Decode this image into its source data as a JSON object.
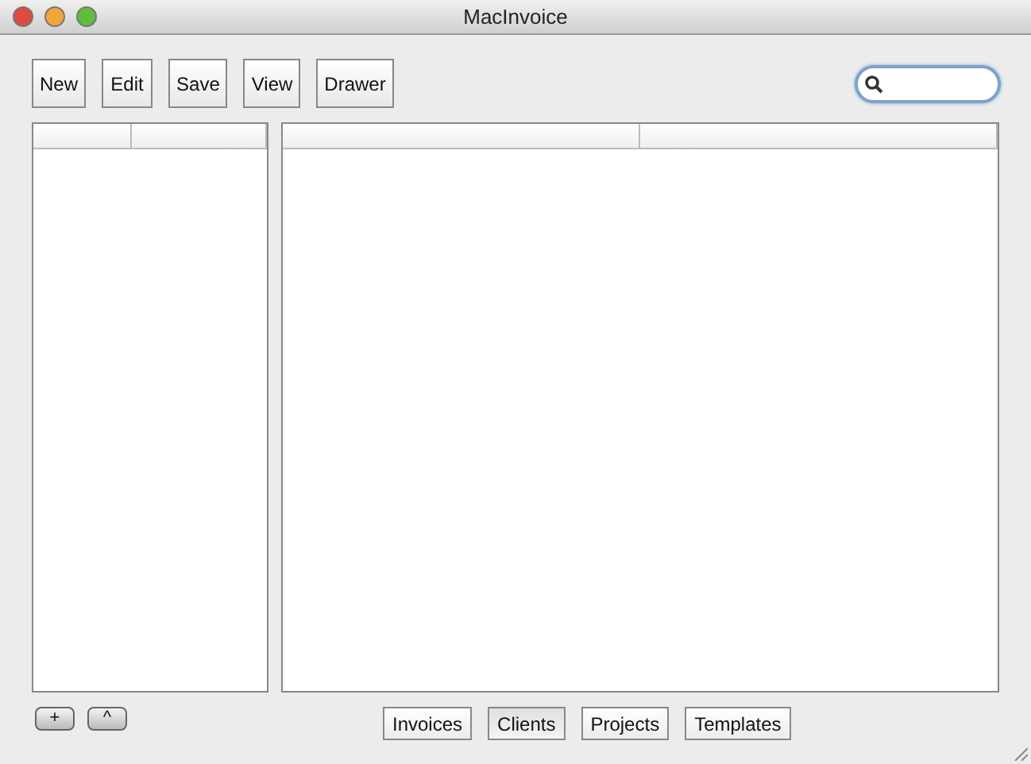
{
  "window": {
    "title": "MacInvoice"
  },
  "toolbar": {
    "buttons": [
      "New",
      "Edit",
      "Save",
      "View",
      "Drawer"
    ]
  },
  "list_buttons": [
    "+",
    "^"
  ],
  "tabs": [
    {
      "label": "Invoices",
      "selected": false
    },
    {
      "label": "Clients",
      "selected": true
    },
    {
      "label": "Projects",
      "selected": false
    },
    {
      "label": "Templates",
      "selected": false
    }
  ]
}
